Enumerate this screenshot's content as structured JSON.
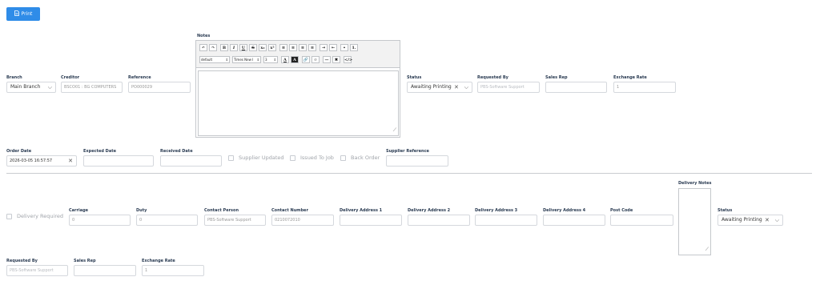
{
  "toolbar": {
    "print_label": "Print"
  },
  "notes": {
    "label": "Notes",
    "format_value": "default",
    "font_value": "Times New I",
    "size_value": "3"
  },
  "header": {
    "branch": {
      "label": "Branch",
      "value": "Main Branch"
    },
    "creditor": {
      "label": "Creditor",
      "value": "BSCO01 : BG COMPUTERS"
    },
    "reference": {
      "label": "Reference",
      "value": "PO000029"
    },
    "status": {
      "label": "Status",
      "value": "Awaiting Printing"
    },
    "requested_by": {
      "label": "Requested By",
      "placeholder": "PBS-Software Support"
    },
    "sales_rep": {
      "label": "Sales Rep",
      "value": ""
    },
    "exchange_rate": {
      "label": "Exchange Rate",
      "value": "1"
    }
  },
  "dates": {
    "order_date": {
      "label": "Order Date",
      "value": "2026-03-05 16:57:57"
    },
    "expected_date": {
      "label": "Expected Date",
      "value": ""
    },
    "received_date": {
      "label": "Received Date",
      "value": ""
    },
    "supplier_updated": "Supplier Updated",
    "issued_to_job": "Issued To Job",
    "back_order": "Back Order",
    "supplier_reference": {
      "label": "Supplier Reference",
      "value": ""
    }
  },
  "delivery": {
    "required_label": "Delivery Required",
    "carriage": {
      "label": "Carriage",
      "value": "0"
    },
    "duty": {
      "label": "Duty",
      "value": "0"
    },
    "contact_person": {
      "label": "Contact Person",
      "value": "PBS-Software Support"
    },
    "contact_number": {
      "label": "Contact Number",
      "value": "0210072010"
    },
    "address1": {
      "label": "Delivery Address 1",
      "value": ""
    },
    "address2": {
      "label": "Delivery Address 2",
      "value": ""
    },
    "address3": {
      "label": "Delivery Address 3",
      "value": ""
    },
    "address4": {
      "label": "Delivery Address 4",
      "value": ""
    },
    "post_code": {
      "label": "Post Code",
      "value": ""
    },
    "notes_label": "Delivery Notes",
    "status": {
      "label": "Status",
      "value": "Awaiting Printing"
    }
  },
  "footer": {
    "requested_by": {
      "label": "Requested By",
      "placeholder": "PBS-Software Support"
    },
    "sales_rep": {
      "label": "Sales Rep",
      "value": ""
    },
    "exchange_rate": {
      "label": "Exchange Rate",
      "value": "1"
    }
  }
}
